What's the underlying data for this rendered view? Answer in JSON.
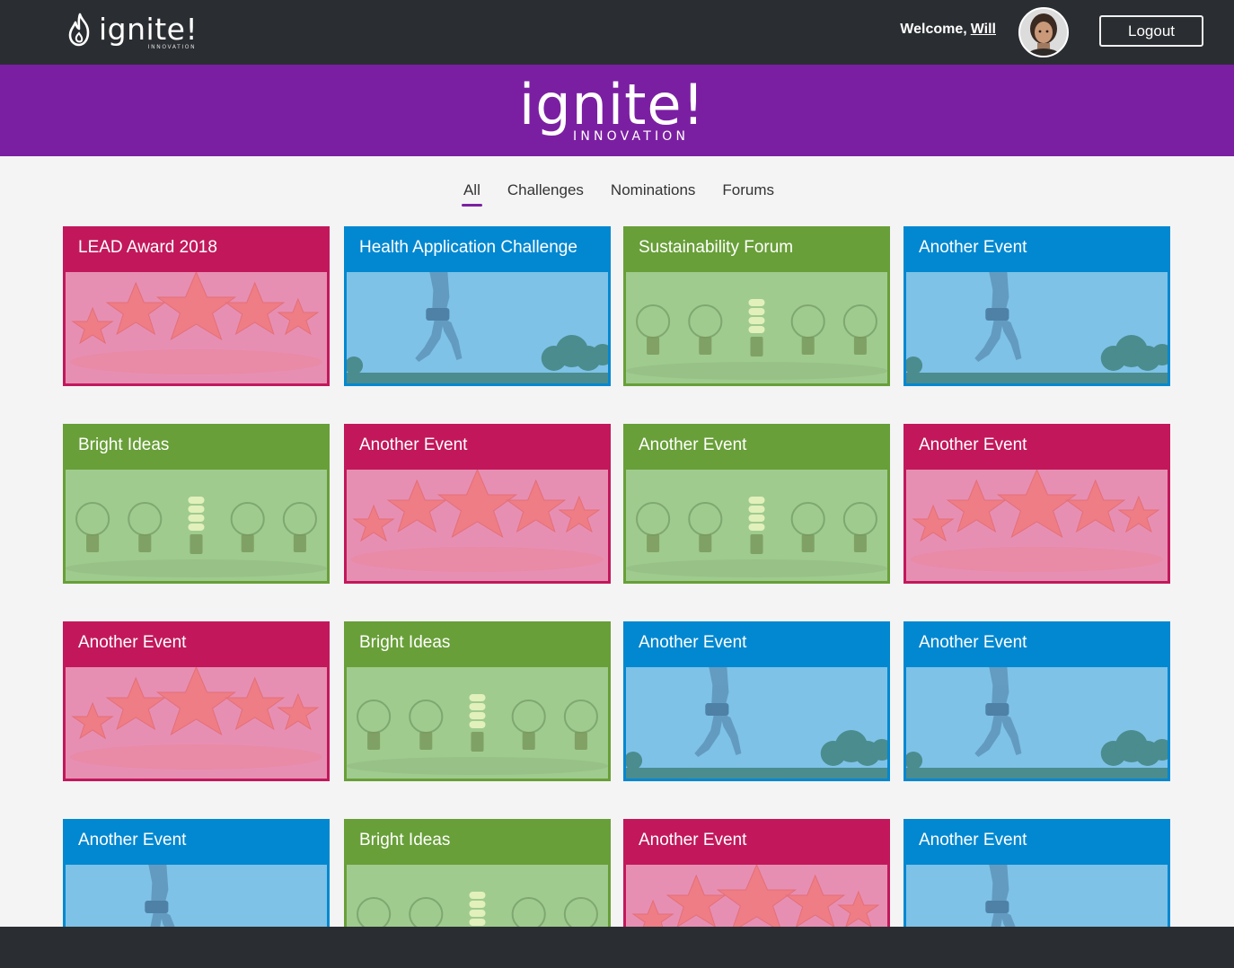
{
  "header": {
    "logo_text": "ignite!",
    "logo_subtext": "INNOVATION",
    "welcome_prefix": "Welcome,",
    "username": "Will",
    "logout_label": "Logout"
  },
  "banner": {
    "logo_text": "ignite!",
    "logo_subtext": "INNOVATION"
  },
  "tabs": [
    {
      "label": "All",
      "active": true
    },
    {
      "label": "Challenges",
      "active": false
    },
    {
      "label": "Nominations",
      "active": false
    },
    {
      "label": "Forums",
      "active": false
    }
  ],
  "cards": [
    {
      "title": "LEAD Award 2018",
      "color": "pink",
      "image": "stars"
    },
    {
      "title": "Health Application Challenge",
      "color": "blue",
      "image": "runner"
    },
    {
      "title": "Sustainability Forum",
      "color": "green",
      "image": "bulbs"
    },
    {
      "title": "Another Event",
      "color": "blue",
      "image": "runner"
    },
    {
      "title": "Bright Ideas",
      "color": "green",
      "image": "bulbs"
    },
    {
      "title": "Another Event",
      "color": "pink",
      "image": "stars"
    },
    {
      "title": "Another Event",
      "color": "green",
      "image": "bulbs"
    },
    {
      "title": "Another Event",
      "color": "pink",
      "image": "stars"
    },
    {
      "title": "Another Event",
      "color": "pink",
      "image": "stars"
    },
    {
      "title": "Bright Ideas",
      "color": "green",
      "image": "bulbs"
    },
    {
      "title": "Another Event",
      "color": "blue",
      "image": "runner"
    },
    {
      "title": "Another Event",
      "color": "blue",
      "image": "runner"
    },
    {
      "title": "Another Event",
      "color": "blue",
      "image": "runner"
    },
    {
      "title": "Bright Ideas",
      "color": "green",
      "image": "bulbs"
    },
    {
      "title": "Another Event",
      "color": "pink",
      "image": "stars"
    },
    {
      "title": "Another Event",
      "color": "blue",
      "image": "runner"
    }
  ],
  "colors": {
    "topbar": "#2a2d31",
    "brand_purple": "#7b1fa2",
    "pink": "#c2185b",
    "blue": "#0288d1",
    "green": "#689f38"
  }
}
